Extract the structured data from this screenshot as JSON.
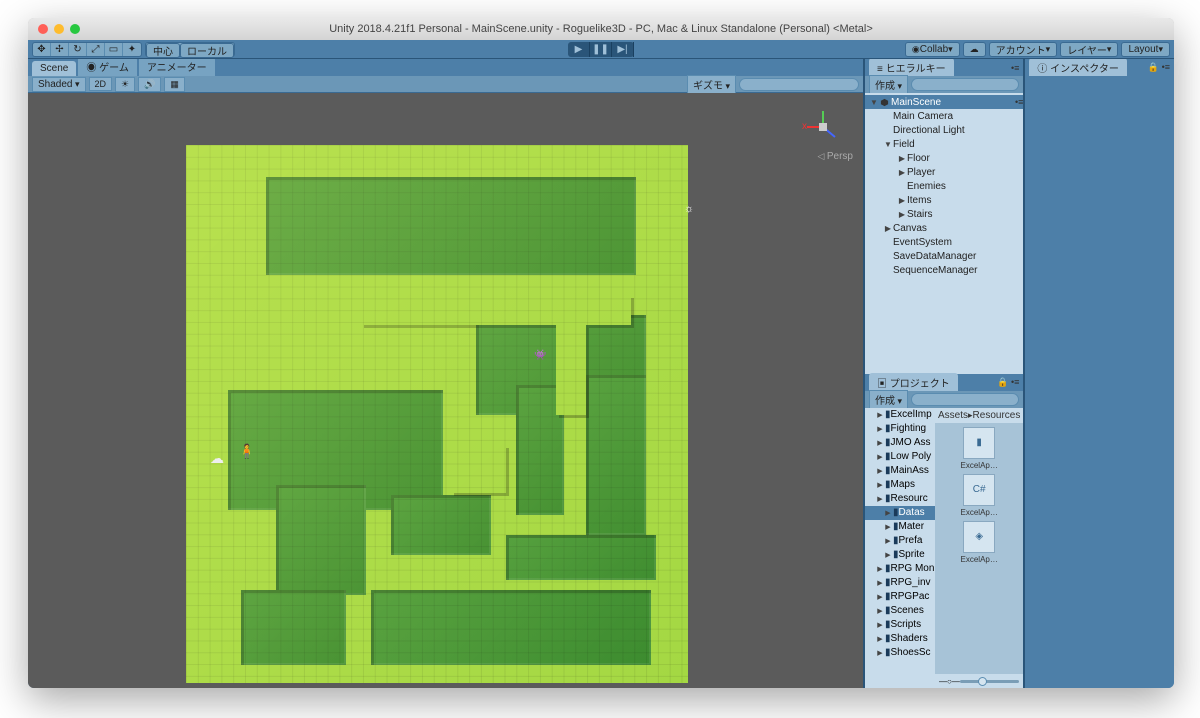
{
  "title": "Unity 2018.4.21f1 Personal - MainScene.unity - Roguelike3D - PC, Mac & Linux Standalone (Personal) <Metal>",
  "toolbar": {
    "pivot_center": "中心",
    "pivot_local": "ローカル",
    "collab": "Collab",
    "account": "アカウント",
    "layers": "レイヤー",
    "layout": "Layout"
  },
  "tabs": {
    "scene": "Scene",
    "game": "ゲーム",
    "animator": "アニメーター",
    "hierarchy": "ヒエラルキー",
    "inspector": "インスペクター",
    "project": "プロジェクト"
  },
  "sceneBar": {
    "shaded": "Shaded",
    "twoD": "2D",
    "gizmos": "ギズモ",
    "persp": "Persp"
  },
  "hierarchy": {
    "create": "作成",
    "root": "MainScene",
    "items": [
      {
        "name": "Main Camera",
        "depth": 1
      },
      {
        "name": "Directional Light",
        "depth": 1
      },
      {
        "name": "Field",
        "depth": 1,
        "fold": "▼"
      },
      {
        "name": "Floor",
        "depth": 2,
        "fold": "▶"
      },
      {
        "name": "Player",
        "depth": 2,
        "fold": "▶"
      },
      {
        "name": "Enemies",
        "depth": 2
      },
      {
        "name": "Items",
        "depth": 2,
        "fold": "▶"
      },
      {
        "name": "Stairs",
        "depth": 2,
        "fold": "▶"
      },
      {
        "name": "Canvas",
        "depth": 1,
        "fold": "▶"
      },
      {
        "name": "EventSystem",
        "depth": 1
      },
      {
        "name": "SaveDataManager",
        "depth": 1
      },
      {
        "name": "SequenceManager",
        "depth": 1
      }
    ]
  },
  "project": {
    "create": "作成",
    "breadcrumb1": "Assets",
    "breadcrumb2": "Resources",
    "folders": [
      "ExcelImp",
      "Fighting",
      "JMO Ass",
      "Low Poly",
      "MainAss",
      "Maps",
      "Resourc",
      "Datas",
      "Mater",
      "Prefa",
      "Sprite",
      "RPG Mon",
      "RPG_inv",
      "RPGPac",
      "Scenes",
      "Scripts",
      "Shaders",
      "ShoesSc"
    ],
    "thumbs": [
      {
        "label": "ExcelAp…",
        "kind": "folder"
      },
      {
        "label": "ExcelAp…",
        "kind": "cs"
      },
      {
        "label": "ExcelAp…",
        "kind": "unity"
      }
    ]
  }
}
